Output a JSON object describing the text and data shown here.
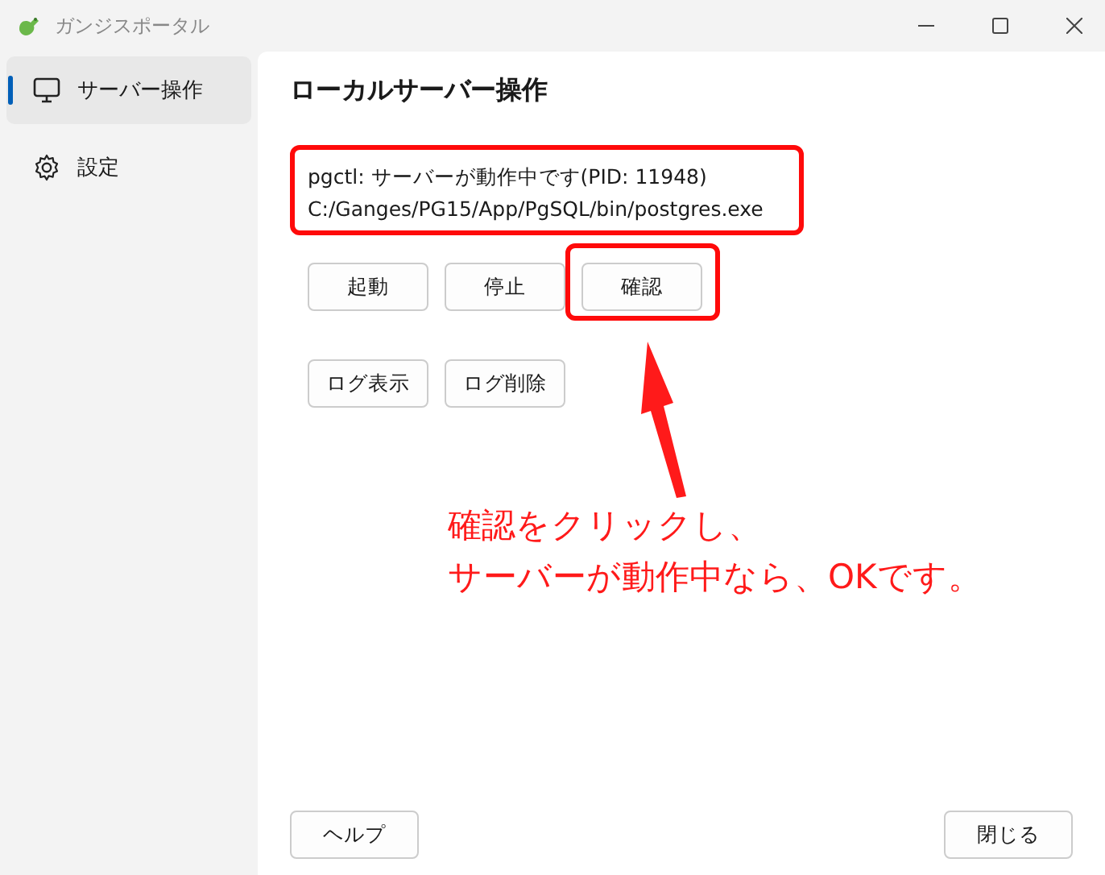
{
  "window": {
    "title": "ガンジスポータル"
  },
  "sidebar": {
    "items": [
      {
        "label": "サーバー操作",
        "selected": true
      },
      {
        "label": "設定",
        "selected": false
      }
    ]
  },
  "page": {
    "title": "ローカルサーバー操作",
    "status_lines": [
      "pgctl: サーバーが動作中です(PID: 11948)",
      "C:/Ganges/PG15/App/PgSQL/bin/postgres.exe"
    ],
    "button_rows": [
      [
        "起動",
        "停止",
        "確認"
      ],
      [
        "ログ表示",
        "ログ削除"
      ]
    ]
  },
  "annotation": {
    "lines": [
      "確認をクリックし、",
      "サーバーが動作中なら、OKです。"
    ]
  },
  "footer": {
    "help": "ヘルプ",
    "close": "閉じる"
  }
}
